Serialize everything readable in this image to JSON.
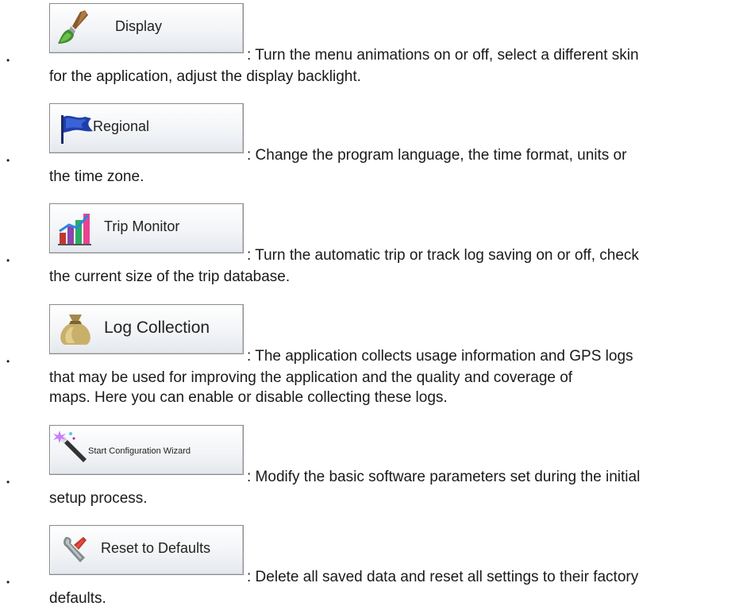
{
  "items": [
    {
      "icon": "paintbrush-icon",
      "button_label": "Display",
      "line1": ": Turn the menu animations on or off, select a different skin",
      "continuation": [
        "for the application, adjust the display backlight."
      ]
    },
    {
      "icon": "blue-flag-icon",
      "button_label": "Regional",
      "line1": ": Change the program language, the time format, units or",
      "continuation": [
        "the time zone."
      ]
    },
    {
      "icon": "bar-chart-icon",
      "button_label": "Trip Monitor",
      "line1": ": Turn the automatic trip or track log saving on or off, check",
      "continuation": [
        "the current size of the trip database."
      ]
    },
    {
      "icon": "money-bag-icon",
      "button_label": "Log Collection",
      "line1": ": The application collects usage information and GPS logs",
      "continuation": [
        "that may be used for improving the application and the quality and coverage of",
        "maps. Here you can enable or disable collecting these logs."
      ]
    },
    {
      "icon": "magic-wand-icon",
      "button_label": "Start Configuration Wizard",
      "line1": ": Modify the basic software parameters set during the initial",
      "continuation": [
        "setup process."
      ]
    },
    {
      "icon": "reset-wrench-icon",
      "button_label": "Reset to Defaults",
      "line1": ": Delete all saved data and reset all settings to their factory",
      "continuation": [
        "defaults."
      ]
    }
  ]
}
